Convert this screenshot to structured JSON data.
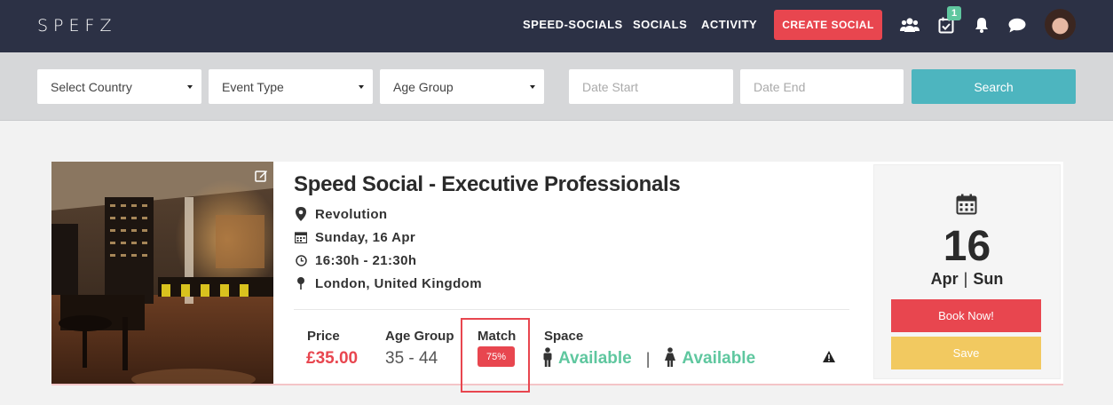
{
  "app": {
    "logo": "SPEFZ"
  },
  "nav": {
    "links": [
      "SPEED-SOCIALS",
      "SOCIALS",
      "ACTIVITY"
    ],
    "create_label": "CREATE SOCIAL",
    "icons": [
      "users-icon",
      "calendar-check-icon",
      "bell-icon",
      "chat-icon"
    ],
    "notification_count": "1"
  },
  "filters": {
    "country": "Select Country",
    "event_type": "Event Type",
    "age_group": "Age Group",
    "date_start_placeholder": "Date Start",
    "date_end_placeholder": "Date End",
    "search_label": "Search"
  },
  "event": {
    "title": "Speed Social - Executive Professionals",
    "venue": "Revolution",
    "date": "Sunday, 16 Apr",
    "time": "16:30h - 21:30h",
    "location": "London, United Kingdom",
    "price_label": "Price",
    "price": "£35.00",
    "age_label": "Age Group",
    "age": "35 - 44",
    "match_label": "Match",
    "match": "75%",
    "space_label": "Space",
    "male_space": "Available",
    "female_space": "Available",
    "day": "16",
    "month": "Apr",
    "weekday": "Sun",
    "book_label": "Book Now!",
    "save_label": "Save"
  },
  "colors": {
    "nav_bg": "#2c3145",
    "accent_red": "#e8464f",
    "teal": "#4db5bf",
    "green": "#5fc79f",
    "yellow": "#f2c960"
  }
}
